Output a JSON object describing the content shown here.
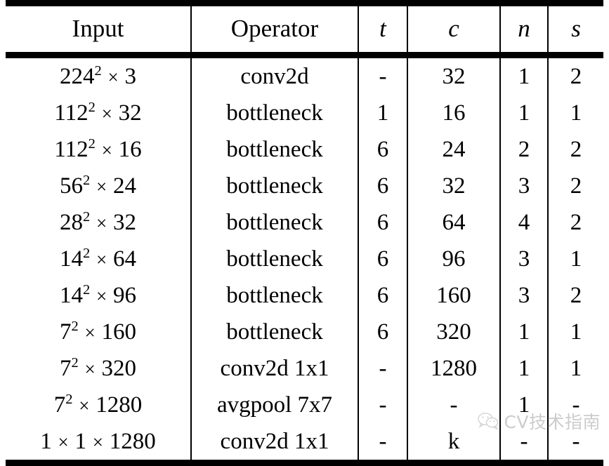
{
  "table": {
    "columns": [
      {
        "key": "input",
        "label": "Input",
        "style": "roman"
      },
      {
        "key": "operator",
        "label": "Operator",
        "style": "roman"
      },
      {
        "key": "t",
        "label": "t",
        "style": "italic"
      },
      {
        "key": "c",
        "label": "c",
        "style": "italic"
      },
      {
        "key": "n",
        "label": "n",
        "style": "italic"
      },
      {
        "key": "s",
        "label": "s",
        "style": "italic"
      }
    ],
    "rows": [
      {
        "input_base": "224",
        "input_exp": "2",
        "input_ch": "3",
        "input": "224² × 3",
        "operator": "conv2d",
        "t": "-",
        "c": "32",
        "n": "1",
        "s": "2"
      },
      {
        "input_base": "112",
        "input_exp": "2",
        "input_ch": "32",
        "input": "112² × 32",
        "operator": "bottleneck",
        "t": "1",
        "c": "16",
        "n": "1",
        "s": "1"
      },
      {
        "input_base": "112",
        "input_exp": "2",
        "input_ch": "16",
        "input": "112² × 16",
        "operator": "bottleneck",
        "t": "6",
        "c": "24",
        "n": "2",
        "s": "2"
      },
      {
        "input_base": "56",
        "input_exp": "2",
        "input_ch": "24",
        "input": "56² × 24",
        "operator": "bottleneck",
        "t": "6",
        "c": "32",
        "n": "3",
        "s": "2"
      },
      {
        "input_base": "28",
        "input_exp": "2",
        "input_ch": "32",
        "input": "28² × 32",
        "operator": "bottleneck",
        "t": "6",
        "c": "64",
        "n": "4",
        "s": "2"
      },
      {
        "input_base": "14",
        "input_exp": "2",
        "input_ch": "64",
        "input": "14² × 64",
        "operator": "bottleneck",
        "t": "6",
        "c": "96",
        "n": "3",
        "s": "1"
      },
      {
        "input_base": "14",
        "input_exp": "2",
        "input_ch": "96",
        "input": "14² × 96",
        "operator": "bottleneck",
        "t": "6",
        "c": "160",
        "n": "3",
        "s": "2"
      },
      {
        "input_base": "7",
        "input_exp": "2",
        "input_ch": "160",
        "input": "7² × 160",
        "operator": "bottleneck",
        "t": "6",
        "c": "320",
        "n": "1",
        "s": "1"
      },
      {
        "input_base": "7",
        "input_exp": "2",
        "input_ch": "320",
        "input": "7² × 320",
        "operator": "conv2d 1x1",
        "t": "-",
        "c": "1280",
        "n": "1",
        "s": "1"
      },
      {
        "input_base": "7",
        "input_exp": "2",
        "input_ch": "1280",
        "input": "7² × 1280",
        "operator": "avgpool 7x7",
        "t": "-",
        "c": "-",
        "n": "1",
        "s": "-"
      },
      {
        "input_base": "1",
        "input_exp": "",
        "input_ch": "1280",
        "input": "1 × 1 × 1280",
        "operator": "conv2d 1x1",
        "t": "-",
        "c": "k",
        "n": "-",
        "s": "-"
      }
    ]
  },
  "watermark": {
    "text": "CV技术指南",
    "icon": "wechat-icon",
    "color": "#7a7a7a"
  },
  "symbols": {
    "times": "×",
    "dash": "-"
  }
}
